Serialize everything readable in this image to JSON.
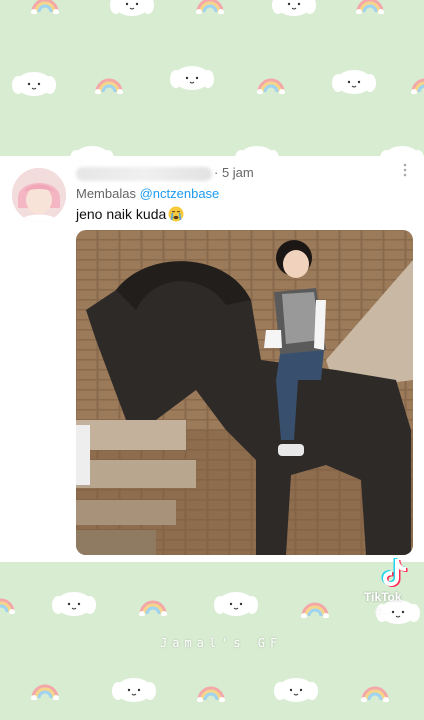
{
  "post": {
    "time": "· 5 jam",
    "reply_prefix": "Membalas",
    "reply_mention": "@nctzenbase",
    "text": "jeno naik kuda"
  },
  "overlay": {
    "tiktok_label": "TikTok",
    "tiktok_handle": "@...",
    "watermark": "Jamal's GF"
  },
  "icons": {
    "more": "more-vertical-icon",
    "emoji": "crying-face-emoji",
    "wallpaper_pattern": [
      "dog-face-icon",
      "rainbow-icon"
    ]
  },
  "colors": {
    "wallpaper_bg": "#d8ecd2",
    "mention": "#1d9bf0",
    "card_bg": "#ffffff"
  }
}
